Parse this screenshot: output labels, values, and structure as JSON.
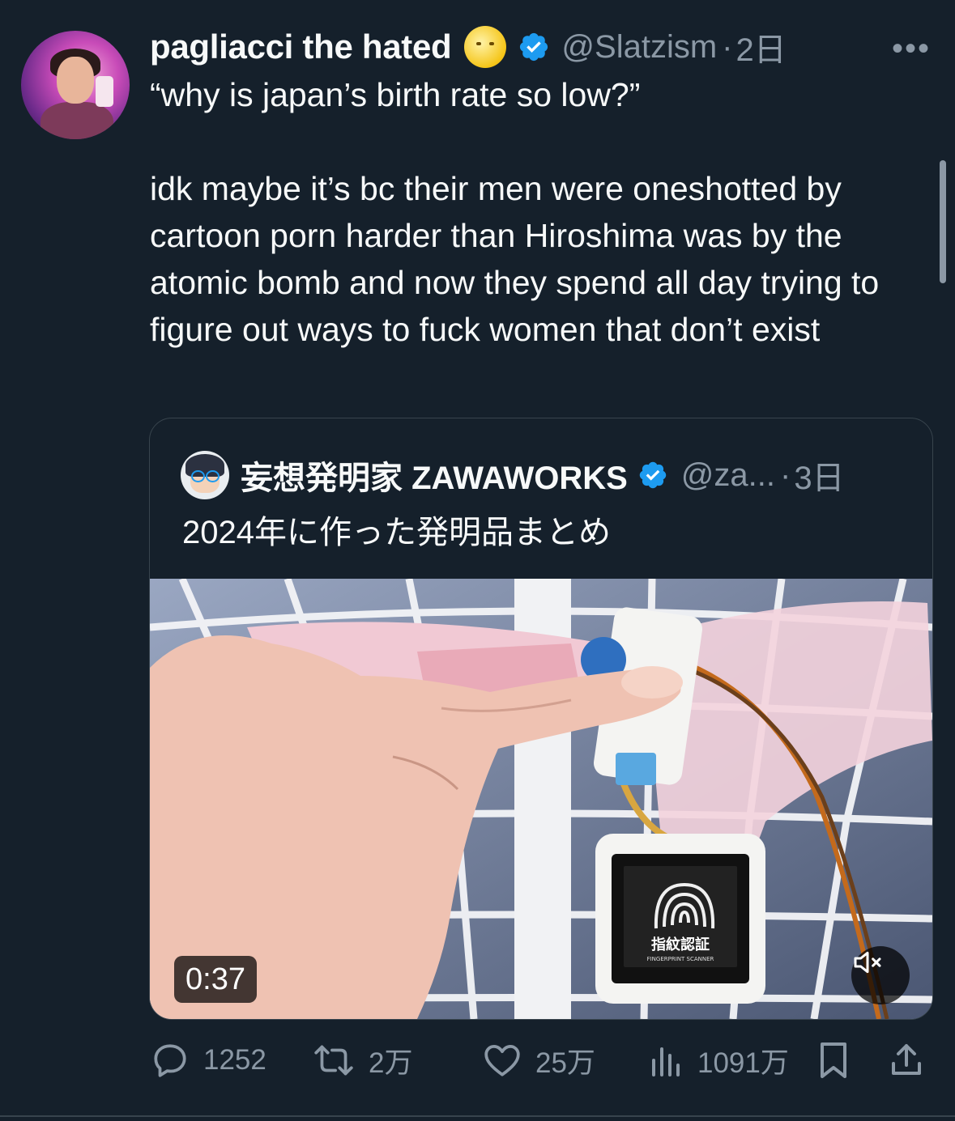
{
  "tweet": {
    "author_name": "pagliacci the hated",
    "author_emoji_icon": "full-moon-face-icon",
    "author_handle": "@Slatzism",
    "separator": "·",
    "time": "2日",
    "more_label": "•••",
    "text": "“why is japan’s birth rate so low?”\n\nidk maybe it’s bc their men were oneshotted by cartoon porn harder than Hiroshima was by the atomic bomb and now they spend all day trying to figure out ways to fuck women that don’t exist"
  },
  "quoted": {
    "author_name": "妄想発明家 ZAWAWORKS",
    "author_handle": "@za...",
    "separator": "·",
    "time": "3日",
    "text": "2024年に作った発明品まとめ",
    "video": {
      "duration": "0:37",
      "device_screen_label": "指紋認証",
      "device_screen_sublabel": "FINGERPRINT SCANNER",
      "mute_icon": "volume-muted-icon"
    }
  },
  "actions": {
    "replies": "1252",
    "reposts": "2万",
    "likes": "25万",
    "views": "1091万"
  },
  "colors": {
    "background": "#15202b",
    "text": "#f7f9f9",
    "secondary_text": "#8b98a5",
    "verified_badge": "#1d9bf0",
    "border": "#38444d"
  }
}
